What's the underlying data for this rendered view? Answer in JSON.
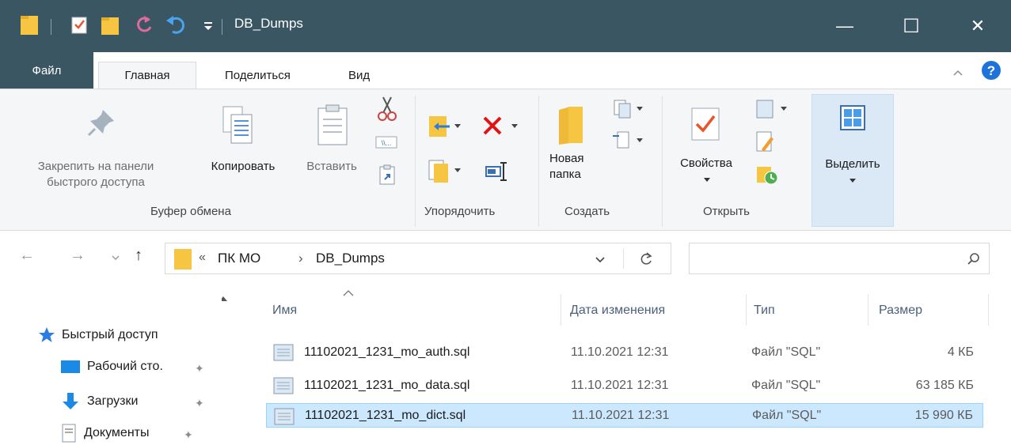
{
  "window": {
    "title": "DB_Dumps",
    "minimize_glyph": "—",
    "maximize_glyph": "☐",
    "close_glyph": "✕"
  },
  "tabs": {
    "file": "Файл",
    "home": "Главная",
    "share": "Поделиться",
    "view": "Вид"
  },
  "ribbon": {
    "pin_label_1": "Закрепить на панели",
    "pin_label_2": "быстрого доступа",
    "copy": "Копировать",
    "paste": "Вставить",
    "clipboard_group": "Буфер обмена",
    "organize_group": "Упорядочить",
    "new_folder_1": "Новая",
    "new_folder_2": "папка",
    "create_group": "Создать",
    "properties": "Свойства",
    "open_group": "Открыть",
    "select": "Выделить"
  },
  "address": {
    "overflow": "«",
    "crumb_1": "ПК МО",
    "separator": "›",
    "crumb_2": "DB_Dumps"
  },
  "navpane": {
    "items": [
      {
        "label": "Быстрый доступ",
        "icon": "star-icon"
      },
      {
        "label": "Рабочий сто.",
        "icon": "desktop-icon"
      },
      {
        "label": "Загрузки",
        "icon": "download-icon"
      },
      {
        "label": "Документы",
        "icon": "documents-icon"
      }
    ]
  },
  "columns": {
    "name": "Имя",
    "date": "Дата изменения",
    "type": "Тип",
    "size": "Размер"
  },
  "files": [
    {
      "name": "11102021_1231_mo_auth.sql",
      "date": "11.10.2021 12:31",
      "type": "Файл \"SQL\"",
      "size": "4 КБ"
    },
    {
      "name": "11102021_1231_mo_data.sql",
      "date": "11.10.2021 12:31",
      "type": "Файл \"SQL\"",
      "size": "63 185 КБ"
    },
    {
      "name": "11102021_1231_mo_dict.sql",
      "date": "11.10.2021 12:31",
      "type": "Файл \"SQL\"",
      "size": "15 990 КБ"
    }
  ],
  "colors": {
    "titlebar": "#3a5663",
    "selection": "#cce8ff",
    "folder": "#f6c642",
    "help": "#1e73d9"
  }
}
